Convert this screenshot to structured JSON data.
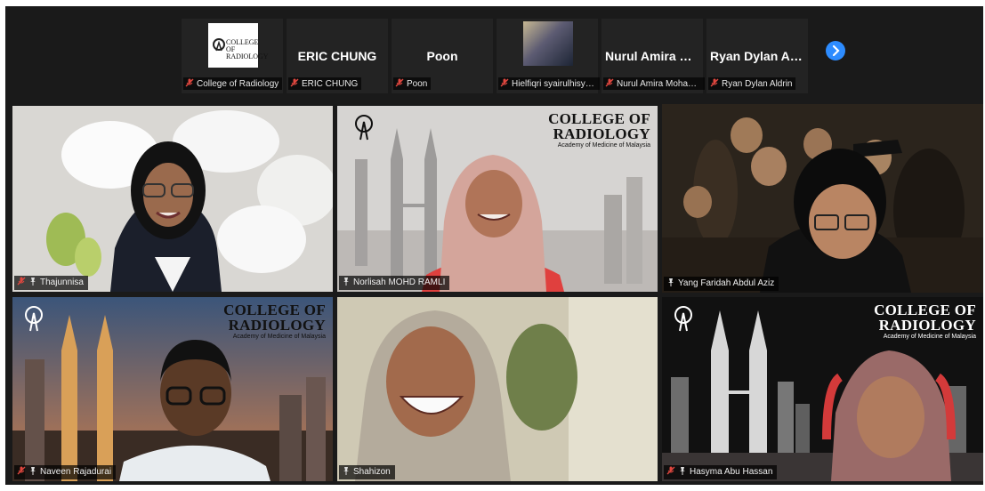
{
  "strip": {
    "thumbs": [
      {
        "name": "",
        "label": "College of Radiology",
        "logo_text": "COLLEGE OF RADIOLOGY"
      },
      {
        "name": "ERIC CHUNG",
        "label": "ERIC CHUNG"
      },
      {
        "name": "Poon",
        "label": "Poon"
      },
      {
        "name": "",
        "label": "Hielfiqri syairulhisyam ..."
      },
      {
        "name": "Nurul Amira M...",
        "label": "Nurul Amira Mohamed"
      },
      {
        "name": "Ryan Dylan Aldrin",
        "label": "Ryan Dylan Aldrin"
      }
    ],
    "next_icon": "chevron-right-icon"
  },
  "participants": [
    {
      "label": "Thajunnisa"
    },
    {
      "label": "Norlisah MOHD RAMLI"
    },
    {
      "label": "Yang Faridah Abdul Aziz"
    },
    {
      "label": "Naveen Rajadurai"
    },
    {
      "label": "Shahizon"
    },
    {
      "label": "Hasyma Abu Hassan"
    }
  ],
  "watermark": {
    "line1": "COLLEGE OF",
    "line2": "RADIOLOGY",
    "line3": "Academy of Medicine of Malaysia"
  },
  "colors": {
    "app_bg": "#1a1a1a",
    "accent_blue": "#2d8cff",
    "muted_red": "#e0473f",
    "active_border": "#cfe37a"
  }
}
